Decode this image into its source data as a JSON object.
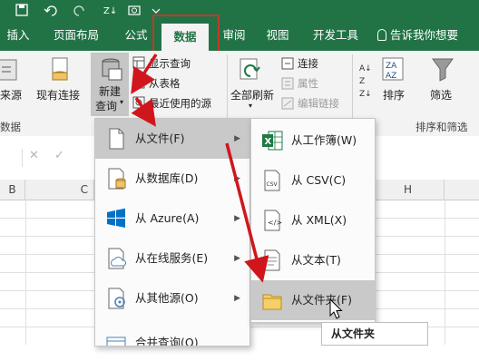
{
  "ribbon_tabs": [
    "插入",
    "页面布局",
    "公式",
    "数据",
    "审阅",
    "视图",
    "开发工具"
  ],
  "tell_me": "告诉我你想要",
  "ribbon": {
    "get_source": "获取外部数据",
    "get_source_short": "来源",
    "existing_conn": "现有连接",
    "new_query_line1": "新建",
    "new_query_line2": "查询",
    "show_queries": "显示查询",
    "from_table": "从表格",
    "recent_sources": "最近使用的源",
    "refresh_all": "全部刷新",
    "connections": "连接",
    "properties": "属性",
    "edit_links": "编辑链接",
    "sort": "排序",
    "filter": "筛选",
    "group_data": "数据",
    "group_sort_filter": "排序和筛选"
  },
  "formula_bar": {
    "cancel": "✕",
    "confirm": "✓"
  },
  "columns": [
    "B",
    "C",
    "H"
  ],
  "menu_main": [
    {
      "label": "从文件(F)",
      "icon": "file-icon"
    },
    {
      "label": "从数据库(D)",
      "icon": "database-icon"
    },
    {
      "label": "从 Azure(A)",
      "icon": "azure-icon"
    },
    {
      "label": "从在线服务(E)",
      "icon": "cloud-icon"
    },
    {
      "label": "从其他源(O)",
      "icon": "other-source-icon"
    },
    {
      "label": "合并查询(Q)",
      "icon": "combine-icon"
    }
  ],
  "menu_sub": [
    {
      "label": "从工作簿(W)",
      "icon": "excel-workbook-icon"
    },
    {
      "label": "从 CSV(C)",
      "icon": "csv-file-icon"
    },
    {
      "label": "从 XML(X)",
      "icon": "xml-file-icon"
    },
    {
      "label": "从文本(T)",
      "icon": "text-file-icon"
    },
    {
      "label": "从文件夹(F)",
      "icon": "folder-icon"
    }
  ],
  "tooltip": "从文件夹",
  "colors": {
    "excel_green": "#217346",
    "annotation_red": "#d0161c",
    "highlight": "#c9c9c9"
  }
}
